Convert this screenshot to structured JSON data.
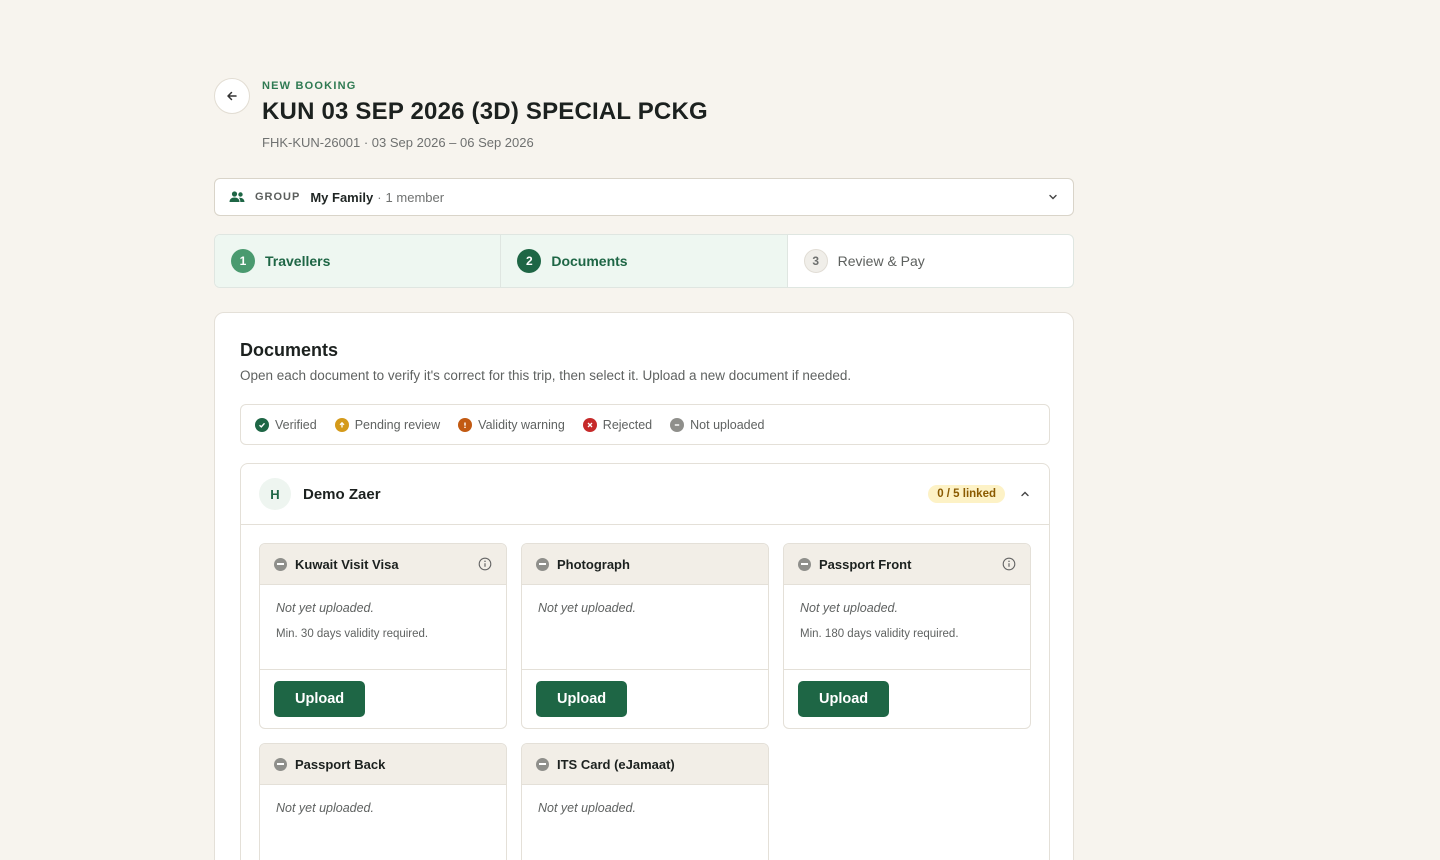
{
  "header": {
    "eyebrow": "NEW BOOKING",
    "title": "KUN 03 SEP 2026 (3D) SPECIAL PCKG",
    "subtitle": "FHK-KUN-26001 · 03 Sep 2026 – 06 Sep 2026"
  },
  "group": {
    "label": "GROUP",
    "name": "My Family",
    "separator": "·",
    "count": "1 member"
  },
  "steps": [
    {
      "number": "1",
      "label": "Travellers"
    },
    {
      "number": "2",
      "label": "Documents"
    },
    {
      "number": "3",
      "label": "Review & Pay"
    }
  ],
  "documents_section": {
    "title": "Documents",
    "description": "Open each document to verify it's correct for this trip, then select it. Upload a new document if needed.",
    "legend": [
      {
        "label": "Verified",
        "color": "#1e6645"
      },
      {
        "label": "Pending review",
        "color": "#d49a1a"
      },
      {
        "label": "Validity warning",
        "color": "#c25a12"
      },
      {
        "label": "Rejected",
        "color": "#c62a2a"
      },
      {
        "label": "Not uploaded",
        "color": "#8f8f8b"
      }
    ]
  },
  "traveller": {
    "initial": "H",
    "name": "Demo Zaer",
    "badge": "0 / 5 linked",
    "documents": [
      {
        "title": "Kuwait Visit Visa",
        "status": "Not yet uploaded.",
        "requirement": "Min. 30 days validity required.",
        "upload_label": "Upload"
      },
      {
        "title": "Photograph",
        "status": "Not yet uploaded.",
        "requirement": "",
        "upload_label": "Upload"
      },
      {
        "title": "Passport Front",
        "status": "Not yet uploaded.",
        "requirement": "Min. 180 days validity required.",
        "upload_label": "Upload"
      },
      {
        "title": "Passport Back",
        "status": "Not yet uploaded.",
        "requirement": ""
      },
      {
        "title": "ITS Card (eJamaat)",
        "status": "Not yet uploaded.",
        "requirement": ""
      }
    ]
  },
  "colors": {
    "brand": "#1e6645",
    "background": "#f7f4ee"
  }
}
